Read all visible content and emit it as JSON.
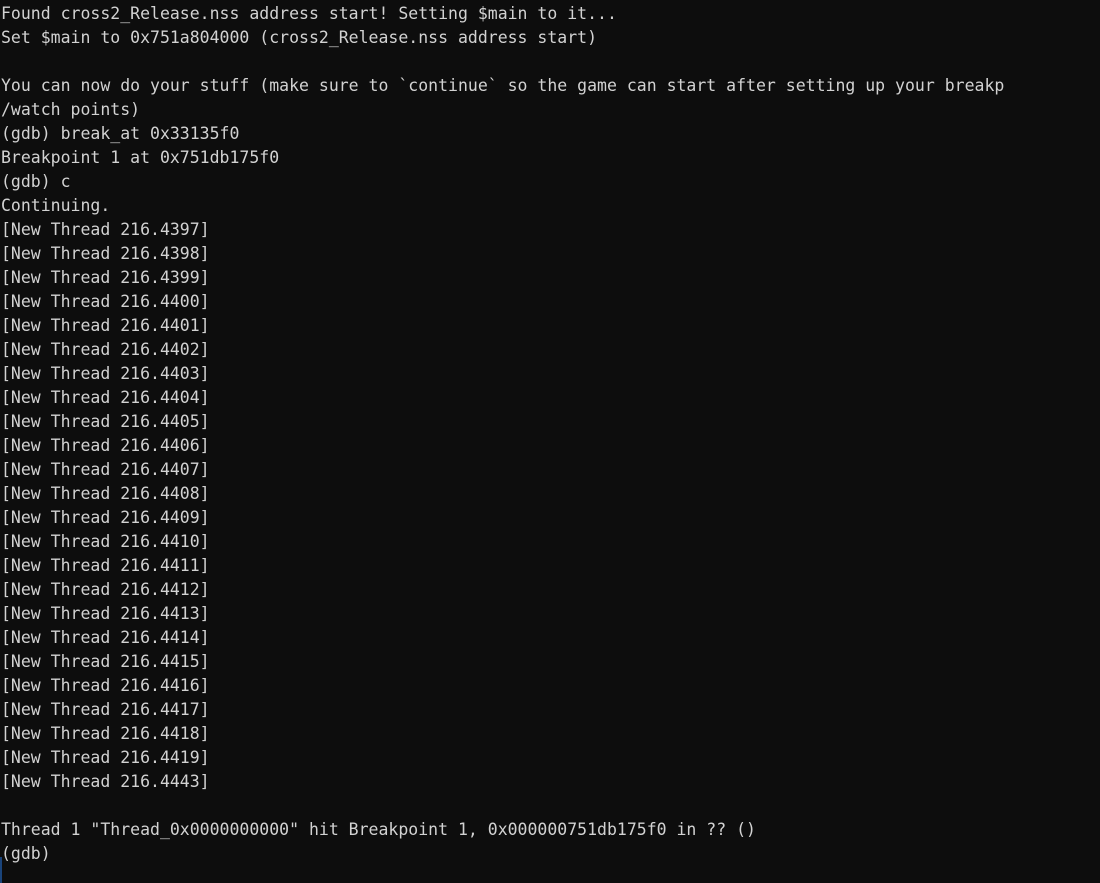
{
  "terminal": {
    "background_color": "#0d0d0d",
    "text_color": "#d2d2d2",
    "accent_color": "#1d4f8f",
    "columns": 100,
    "prompt": "(gdb)",
    "lines": [
      "Found cross2_Release.nss address start! Setting $main to it...",
      "Set $main to 0x751a804000 (cross2_Release.nss address start)",
      "",
      "You can now do your stuff (make sure to `continue` so the game can start after setting up your breakp",
      "/watch points)",
      "(gdb) break_at 0x33135f0",
      "Breakpoint 1 at 0x751db175f0",
      "(gdb) c",
      "Continuing.",
      "[New Thread 216.4397]",
      "[New Thread 216.4398]",
      "[New Thread 216.4399]",
      "[New Thread 216.4400]",
      "[New Thread 216.4401]",
      "[New Thread 216.4402]",
      "[New Thread 216.4403]",
      "[New Thread 216.4404]",
      "[New Thread 216.4405]",
      "[New Thread 216.4406]",
      "[New Thread 216.4407]",
      "[New Thread 216.4408]",
      "[New Thread 216.4409]",
      "[New Thread 216.4410]",
      "[New Thread 216.4411]",
      "[New Thread 216.4412]",
      "[New Thread 216.4413]",
      "[New Thread 216.4414]",
      "[New Thread 216.4415]",
      "[New Thread 216.4416]",
      "[New Thread 216.4417]",
      "[New Thread 216.4418]",
      "[New Thread 216.4419]",
      "[New Thread 216.4443]",
      "",
      "Thread 1 \"Thread_0x0000000000\" hit Breakpoint 1, 0x000000751db175f0 in ?? ()",
      "(gdb)"
    ]
  }
}
